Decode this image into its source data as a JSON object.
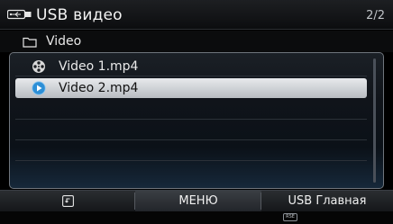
{
  "header": {
    "title": "USB видео",
    "page_indicator": "2/2",
    "icon": "usb-icon"
  },
  "folder": {
    "label": "Video",
    "icon": "folder-icon"
  },
  "files": [
    {
      "label": "Video 1.mp4",
      "icon": "film-reel-icon",
      "selected": false
    },
    {
      "label": "Video 2.mp4",
      "icon": "play-icon",
      "selected": true
    }
  ],
  "bottom_bar": {
    "back_icon": "back-icon",
    "menu_label": "МЕНЮ",
    "main_label": "USB Главная"
  },
  "status": {
    "badge": "RSE"
  },
  "colors": {
    "selected_row": "#dfe2e6",
    "panel_border": "#6f757c",
    "play_icon": "#2d8fd6"
  }
}
